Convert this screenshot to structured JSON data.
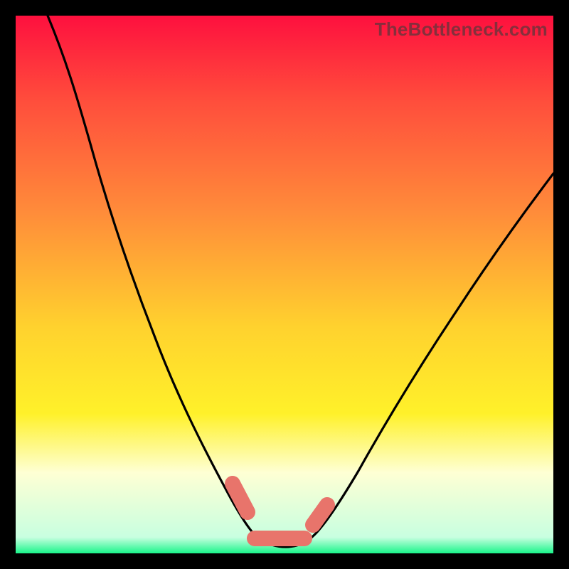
{
  "watermark": "TheBottleneck.com",
  "colors": {
    "gradient_top": "#fe103e",
    "gradient_mid1": "#ff8a3a",
    "gradient_mid2": "#fff12a",
    "gradient_pale": "#feffd4",
    "gradient_bottom": "#19f58a",
    "curve_stroke": "#000000",
    "marker_stroke": "#e8746b",
    "frame_bg": "#000000"
  },
  "chart_data": {
    "type": "line",
    "title": "",
    "xlabel": "",
    "ylabel": "",
    "xlim": [
      0,
      100
    ],
    "ylim": [
      0,
      100
    ],
    "grid": false,
    "legend": false,
    "series": [
      {
        "name": "bottleneck-curve",
        "x": [
          6,
          10,
          14,
          18,
          22,
          26,
          30,
          34,
          38,
          42,
          44,
          46,
          48,
          50,
          52,
          54,
          56,
          60,
          66,
          74,
          84,
          94,
          100
        ],
        "y": [
          100,
          88,
          76,
          64,
          53,
          42,
          32,
          23,
          15,
          8,
          5,
          3,
          2,
          2,
          2,
          3,
          5,
          9,
          16,
          26,
          40,
          54,
          62
        ]
      }
    ],
    "markers": [
      {
        "name": "left-hotspot",
        "x_range": [
          40.5,
          43.5
        ],
        "y_range": [
          8,
          13
        ]
      },
      {
        "name": "floor-hotspot",
        "x_range": [
          44.5,
          54.0
        ],
        "y_range": [
          1,
          3
        ]
      },
      {
        "name": "right-hotspot",
        "x_range": [
          55.0,
          58.0
        ],
        "y_range": [
          5,
          9
        ]
      }
    ],
    "annotations": []
  }
}
